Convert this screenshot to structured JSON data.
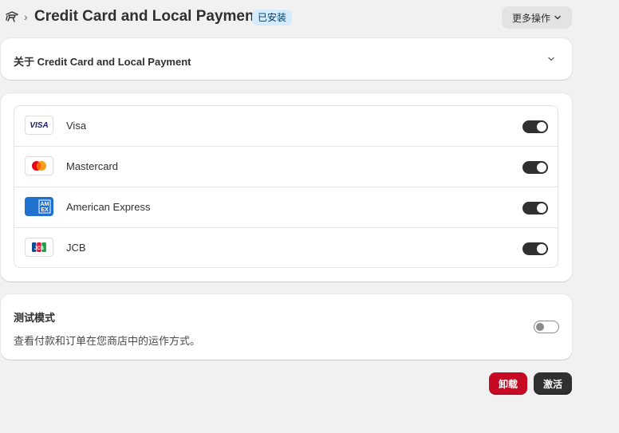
{
  "header": {
    "breadcrumb_separator": "›",
    "title": "Credit Card and Local Payment",
    "status_badge": "已安装",
    "more_actions_label": "更多操作"
  },
  "about": {
    "title": "关于 Credit Card and Local Payment"
  },
  "payment_methods": [
    {
      "name": "Visa",
      "logo": "visa-logo",
      "logo_text": "VISA",
      "enabled": true
    },
    {
      "name": "Mastercard",
      "logo": "mastercard-logo",
      "enabled": true
    },
    {
      "name": "American Express",
      "logo": "amex-logo",
      "logo_text": "AM EX",
      "enabled": true
    },
    {
      "name": "JCB",
      "logo": "jcb-logo",
      "logo_text": "JCB",
      "enabled": true
    }
  ],
  "test_mode": {
    "title": "测试模式",
    "description": "查看付款和订单在您商店中的运作方式。",
    "enabled": false
  },
  "footer": {
    "uninstall_label": "卸载",
    "activate_label": "激活"
  },
  "colors": {
    "page_background": "#f1f1f1",
    "badge_background": "#d5ebff",
    "toggle_on": "#303030",
    "uninstall_button": "#c70a24",
    "activate_button": "#303030"
  }
}
